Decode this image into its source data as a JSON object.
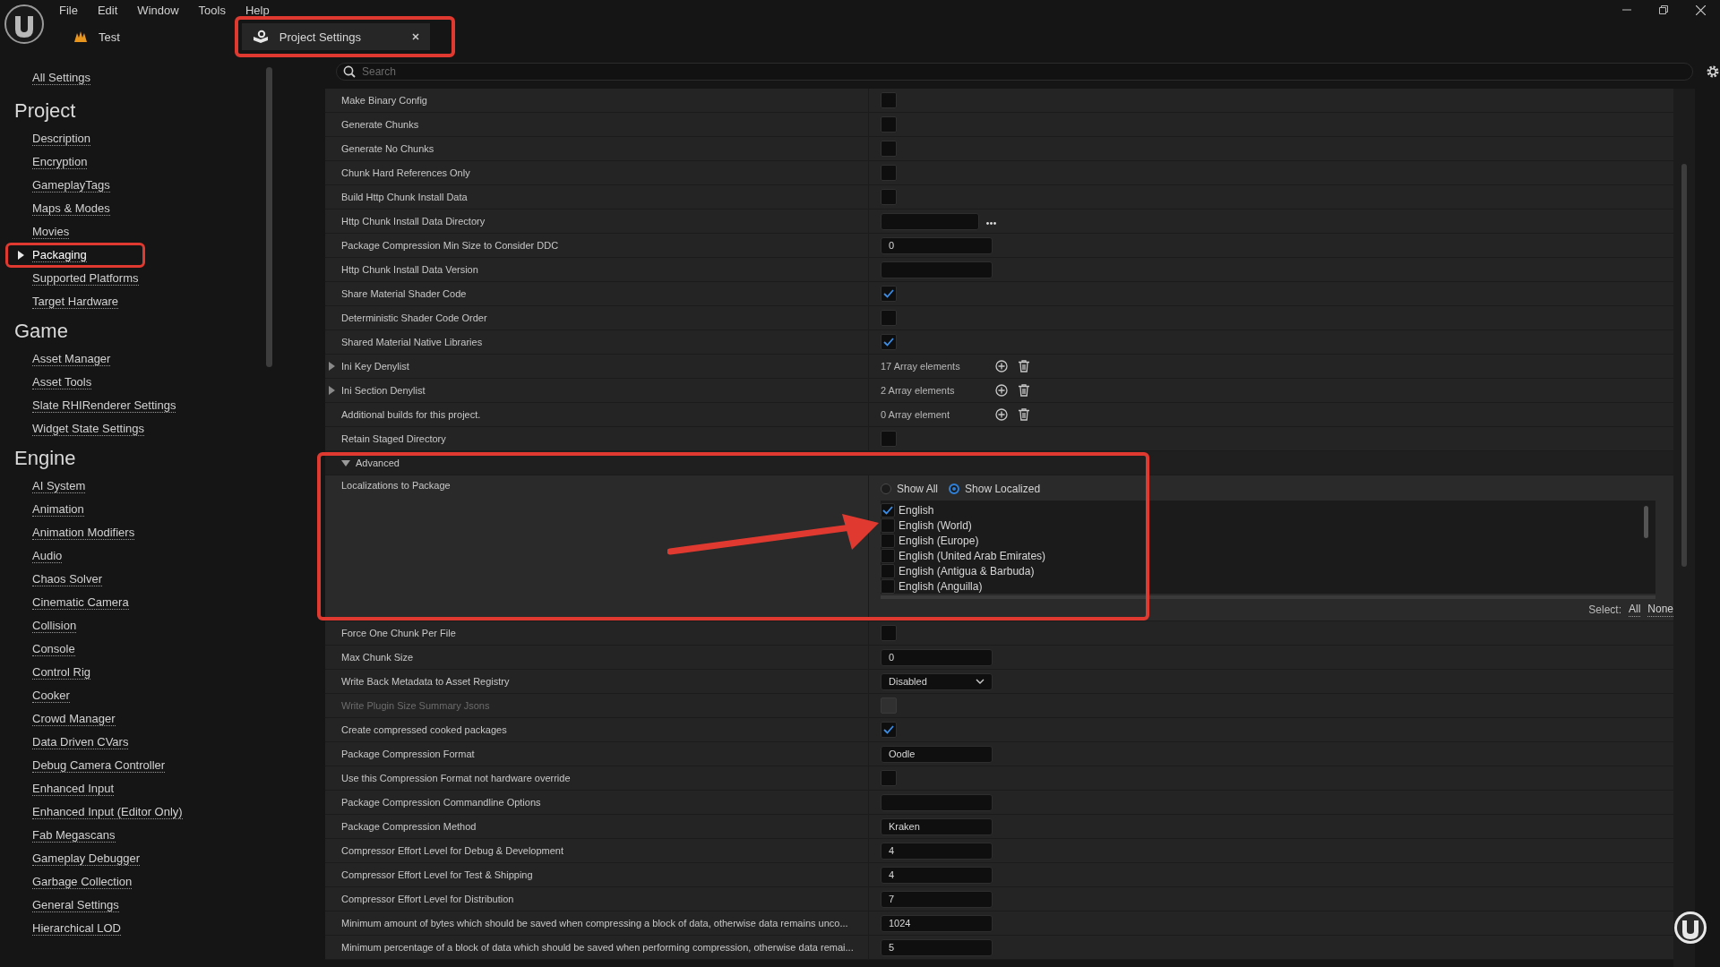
{
  "menu": [
    "File",
    "Edit",
    "Window",
    "Tools",
    "Help"
  ],
  "tabs": [
    {
      "label": "Test",
      "kind": "level",
      "selected": false,
      "highlighted": false
    },
    {
      "label": "Project Settings",
      "kind": "settings",
      "selected": true,
      "highlighted": true
    }
  ],
  "sidebar": {
    "top_link": "All Settings",
    "sections": [
      {
        "title": "Project",
        "items": [
          {
            "label": "Description",
            "selected": false,
            "highlighted": false
          },
          {
            "label": "Encryption",
            "selected": false,
            "highlighted": false
          },
          {
            "label": "GameplayTags",
            "selected": false,
            "highlighted": false
          },
          {
            "label": "Maps & Modes",
            "selected": false,
            "highlighted": false
          },
          {
            "label": "Movies",
            "selected": false,
            "highlighted": false
          },
          {
            "label": "Packaging",
            "selected": true,
            "highlighted": true
          },
          {
            "label": "Supported Platforms",
            "selected": false,
            "highlighted": false
          },
          {
            "label": "Target Hardware",
            "selected": false,
            "highlighted": false
          }
        ]
      },
      {
        "title": "Game",
        "items": [
          {
            "label": "Asset Manager",
            "selected": false,
            "highlighted": false
          },
          {
            "label": "Asset Tools",
            "selected": false,
            "highlighted": false
          },
          {
            "label": "Slate RHIRenderer Settings",
            "selected": false,
            "highlighted": false
          },
          {
            "label": "Widget State Settings",
            "selected": false,
            "highlighted": false
          }
        ]
      },
      {
        "title": "Engine",
        "items": [
          {
            "label": "AI System",
            "selected": false,
            "highlighted": false
          },
          {
            "label": "Animation",
            "selected": false,
            "highlighted": false
          },
          {
            "label": "Animation Modifiers",
            "selected": false,
            "highlighted": false
          },
          {
            "label": "Audio",
            "selected": false,
            "highlighted": false
          },
          {
            "label": "Chaos Solver",
            "selected": false,
            "highlighted": false
          },
          {
            "label": "Cinematic Camera",
            "selected": false,
            "highlighted": false
          },
          {
            "label": "Collision",
            "selected": false,
            "highlighted": false
          },
          {
            "label": "Console",
            "selected": false,
            "highlighted": false
          },
          {
            "label": "Control Rig",
            "selected": false,
            "highlighted": false
          },
          {
            "label": "Cooker",
            "selected": false,
            "highlighted": false
          },
          {
            "label": "Crowd Manager",
            "selected": false,
            "highlighted": false
          },
          {
            "label": "Data Driven CVars",
            "selected": false,
            "highlighted": false
          },
          {
            "label": "Debug Camera Controller",
            "selected": false,
            "highlighted": false
          },
          {
            "label": "Enhanced Input",
            "selected": false,
            "highlighted": false
          },
          {
            "label": "Enhanced Input (Editor Only)",
            "selected": false,
            "highlighted": false
          },
          {
            "label": "Fab Megascans",
            "selected": false,
            "highlighted": false
          },
          {
            "label": "Gameplay Debugger",
            "selected": false,
            "highlighted": false
          },
          {
            "label": "Garbage Collection",
            "selected": false,
            "highlighted": false
          },
          {
            "label": "General Settings",
            "selected": false,
            "highlighted": false
          },
          {
            "label": "Hierarchical LOD",
            "selected": false,
            "highlighted": false
          }
        ]
      }
    ]
  },
  "search": {
    "placeholder": "Search"
  },
  "rows": [
    {
      "kind": "checkbox",
      "label": "Make Binary Config",
      "checked": false,
      "disabled": false
    },
    {
      "kind": "checkbox",
      "label": "Generate Chunks",
      "checked": false,
      "disabled": false
    },
    {
      "kind": "checkbox",
      "label": "Generate No Chunks",
      "checked": false,
      "disabled": false
    },
    {
      "kind": "checkbox",
      "label": "Chunk Hard References Only",
      "checked": false,
      "disabled": false
    },
    {
      "kind": "checkbox",
      "label": "Build Http Chunk Install Data",
      "checked": false,
      "disabled": false
    },
    {
      "kind": "path",
      "label": "Http Chunk Install Data Directory",
      "disabled": false
    },
    {
      "kind": "text",
      "label": "Package Compression Min Size to Consider DDC",
      "value": "0",
      "disabled": false
    },
    {
      "kind": "text",
      "label": "Http Chunk Install Data Version",
      "disabled": false
    },
    {
      "kind": "checkbox",
      "label": "Share Material Shader Code",
      "checked": true,
      "disabled": false
    },
    {
      "kind": "checkbox",
      "label": "Deterministic Shader Code Order",
      "checked": false,
      "disabled": false
    },
    {
      "kind": "checkbox",
      "label": "Shared Material Native Libraries",
      "checked": true,
      "disabled": false
    },
    {
      "kind": "array",
      "label": "Ini Key Denylist",
      "value": "17 Array elements",
      "expanded": false,
      "disabled": false
    },
    {
      "kind": "array",
      "label": "Ini Section Denylist",
      "value": "2 Array elements",
      "expanded": false,
      "disabled": false
    },
    {
      "kind": "array",
      "label": "Additional builds for this project.",
      "value": "0 Array element",
      "disabled": false
    },
    {
      "kind": "checkbox",
      "label": "Retain Staged Directory",
      "checked": false,
      "disabled": false
    },
    {
      "kind": "group",
      "label": "Advanced",
      "expanded": true,
      "highlighted": true,
      "pointer_arrow": true,
      "children": [
        {
          "kind": "localizations",
          "label": "Localizations to Package",
          "disabled": false,
          "filters": [
            {
              "label": "Show All",
              "selected": false
            },
            {
              "label": "Show Localized",
              "selected": true
            }
          ],
          "languages": [
            {
              "label": "English",
              "checked": true
            },
            {
              "label": "English (World)",
              "checked": false
            },
            {
              "label": "English (Europe)",
              "checked": false
            },
            {
              "label": "English (United Arab Emirates)",
              "checked": false
            },
            {
              "label": "English (Antigua & Barbuda)",
              "checked": false
            },
            {
              "label": "English (Anguilla)",
              "checked": false
            }
          ],
          "select_label": "Select:",
          "select_links": [
            "All",
            "None"
          ]
        }
      ]
    },
    {
      "kind": "checkbox",
      "label": "Force One Chunk Per File",
      "checked": false,
      "disabled": false
    },
    {
      "kind": "text",
      "label": "Max Chunk Size",
      "value": "0",
      "disabled": false
    },
    {
      "kind": "dropdown",
      "label": "Write Back Metadata to Asset Registry",
      "value": "Disabled",
      "disabled": false
    },
    {
      "kind": "checkbox",
      "label": "Write Plugin Size Summary Jsons",
      "checked": false,
      "disabled": true
    },
    {
      "kind": "checkbox",
      "label": "Create compressed cooked packages",
      "checked": true,
      "disabled": false
    },
    {
      "kind": "text",
      "label": "Package Compression Format",
      "value": "Oodle",
      "disabled": false
    },
    {
      "kind": "checkbox",
      "label": "Use this Compression Format not hardware override",
      "checked": false,
      "disabled": false
    },
    {
      "kind": "text",
      "label": "Package Compression Commandline Options",
      "disabled": false
    },
    {
      "kind": "text",
      "label": "Package Compression Method",
      "value": "Kraken",
      "disabled": false
    },
    {
      "kind": "text",
      "label": "Compressor Effort Level for Debug & Development",
      "value": "4",
      "disabled": false
    },
    {
      "kind": "text",
      "label": "Compressor Effort Level for Test & Shipping",
      "value": "4",
      "disabled": false
    },
    {
      "kind": "text",
      "label": "Compressor Effort Level for Distribution",
      "value": "7",
      "disabled": false
    },
    {
      "kind": "text",
      "label": "Minimum amount of bytes which should be saved when compressing a block of data, otherwise data remains unco...",
      "value": "1024",
      "disabled": false
    },
    {
      "kind": "text",
      "label": "Minimum percentage of a block of data which should be saved when performing compression, otherwise data remai...",
      "value": "5",
      "disabled": false
    }
  ]
}
